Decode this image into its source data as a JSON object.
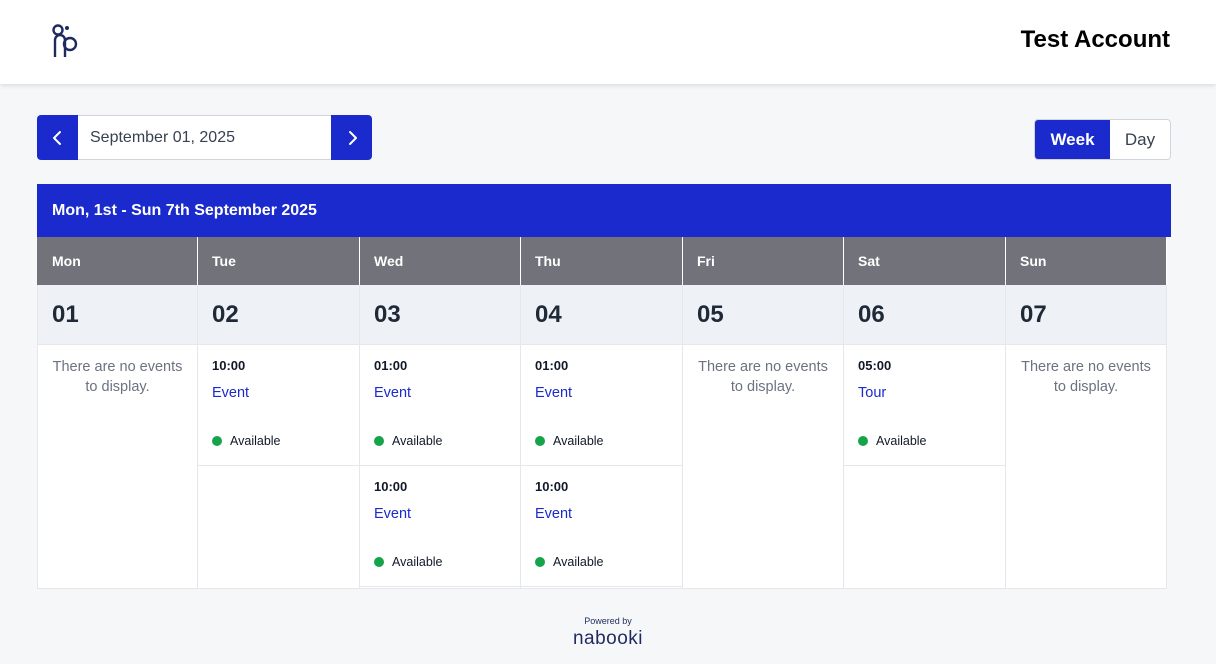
{
  "header": {
    "account_name": "Test Account"
  },
  "date_nav": {
    "current_date": "September 01, 2025"
  },
  "view_toggle": {
    "week_label": "Week",
    "day_label": "Day",
    "active": "Week"
  },
  "calendar": {
    "range_title": "Mon, 1st - Sun 7th September 2025",
    "no_events_text": "There are no events to display.",
    "days": [
      {
        "name": "Mon",
        "number": "01",
        "events": []
      },
      {
        "name": "Tue",
        "number": "02",
        "events": [
          {
            "time": "10:00",
            "title": "Event",
            "status": "Available"
          }
        ]
      },
      {
        "name": "Wed",
        "number": "03",
        "events": [
          {
            "time": "01:00",
            "title": "Event",
            "status": "Available"
          },
          {
            "time": "10:00",
            "title": "Event",
            "status": "Available"
          }
        ]
      },
      {
        "name": "Thu",
        "number": "04",
        "events": [
          {
            "time": "01:00",
            "title": "Event",
            "status": "Available"
          },
          {
            "time": "10:00",
            "title": "Event",
            "status": "Available"
          }
        ]
      },
      {
        "name": "Fri",
        "number": "05",
        "events": []
      },
      {
        "name": "Sat",
        "number": "06",
        "events": [
          {
            "time": "05:00",
            "title": "Tour",
            "status": "Available"
          }
        ]
      },
      {
        "name": "Sun",
        "number": "07",
        "events": []
      }
    ]
  },
  "footer": {
    "powered_by": "Powered by",
    "brand": "nabooki"
  },
  "colors": {
    "accent": "#1a2acc",
    "header_gray": "#71727a",
    "available": "#16a34a"
  },
  "icons": {
    "logo": "nabooki-mark-icon",
    "prev": "chevron-left-icon",
    "next": "chevron-right-icon"
  }
}
